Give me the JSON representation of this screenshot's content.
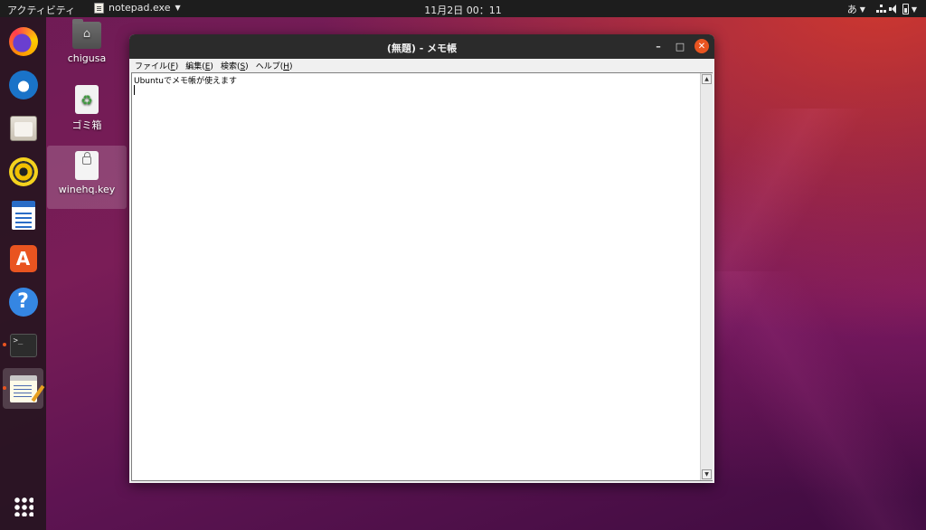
{
  "topbar": {
    "activities": "アクティビティ",
    "app_name": "notepad.exe",
    "clock": "11月2日  00：11",
    "input_method": "あ"
  },
  "dock": {
    "items": [
      {
        "icon": "firefox-icon"
      },
      {
        "icon": "thunderbird-icon"
      },
      {
        "icon": "files-icon"
      },
      {
        "icon": "rhythmbox-icon"
      },
      {
        "icon": "libreoffice-writer-icon"
      },
      {
        "icon": "software-store-icon"
      },
      {
        "icon": "help-icon"
      },
      {
        "icon": "terminal-icon"
      },
      {
        "icon": "notepad-icon"
      },
      {
        "icon": "show-apps-grid-icon"
      }
    ]
  },
  "desktop": {
    "icons": [
      {
        "label": "chigusa",
        "icon": "home-folder-icon"
      },
      {
        "label": "ゴミ箱",
        "icon": "trash-icon"
      },
      {
        "label": "winehq.key",
        "icon": "pgp-key-file-icon"
      }
    ]
  },
  "window": {
    "title": "(無題) - メモ帳",
    "menu": [
      {
        "label": "ファイル(",
        "key": "F",
        "end": ")"
      },
      {
        "label": "編集(",
        "key": "E",
        "end": ")"
      },
      {
        "label": "検索(",
        "key": "S",
        "end": ")"
      },
      {
        "label": "ヘルプ(",
        "key": "H",
        "end": ")"
      }
    ],
    "content": "Ubuntuでメモ帳が使えます"
  }
}
